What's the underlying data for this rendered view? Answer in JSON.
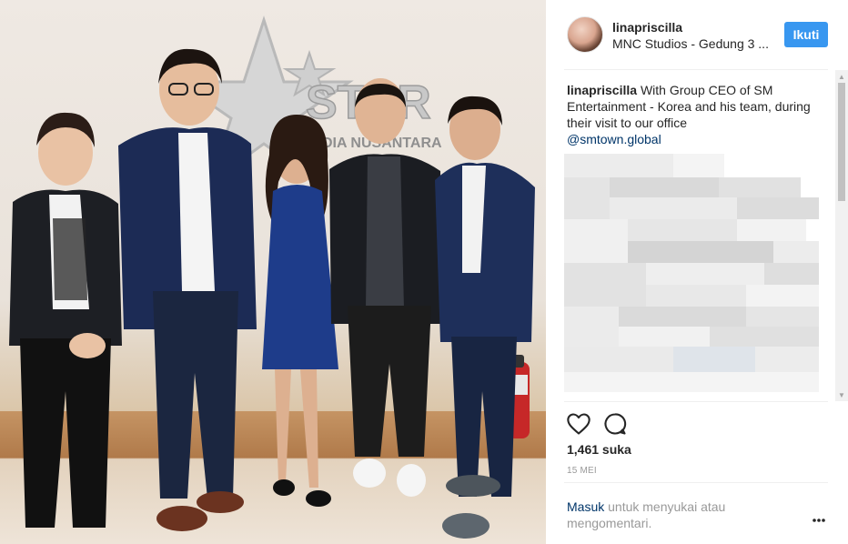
{
  "post": {
    "username": "linapriscilla",
    "location": "MNC Studios - Gedung 3 ...",
    "follow_label": "Ikuti",
    "caption_username": "linapriscilla",
    "caption_text": "With Group CEO of SM Entertainment - Korea and his team, during their visit to our office",
    "caption_mention": "@smtown.global",
    "likes_label": "1,461 suka",
    "date_label": "15 MEI",
    "login_link": "Masuk",
    "login_text": "untuk menyukai atau mengomentari."
  },
  "photo": {
    "sign_text": "STAR",
    "sign_subtext": "MEDIA NUSANTARA"
  },
  "icons": {
    "like": "heart-icon",
    "comment": "comment-bubble-icon",
    "more": "more-options-icon",
    "avatar": "avatar",
    "scroll_up": "scroll-up-arrow",
    "scroll_down": "scroll-down-arrow"
  },
  "colors": {
    "follow_button": "#3897f0",
    "link": "#003569",
    "muted_text": "#999999",
    "text": "#262626",
    "divider": "#efefef"
  }
}
